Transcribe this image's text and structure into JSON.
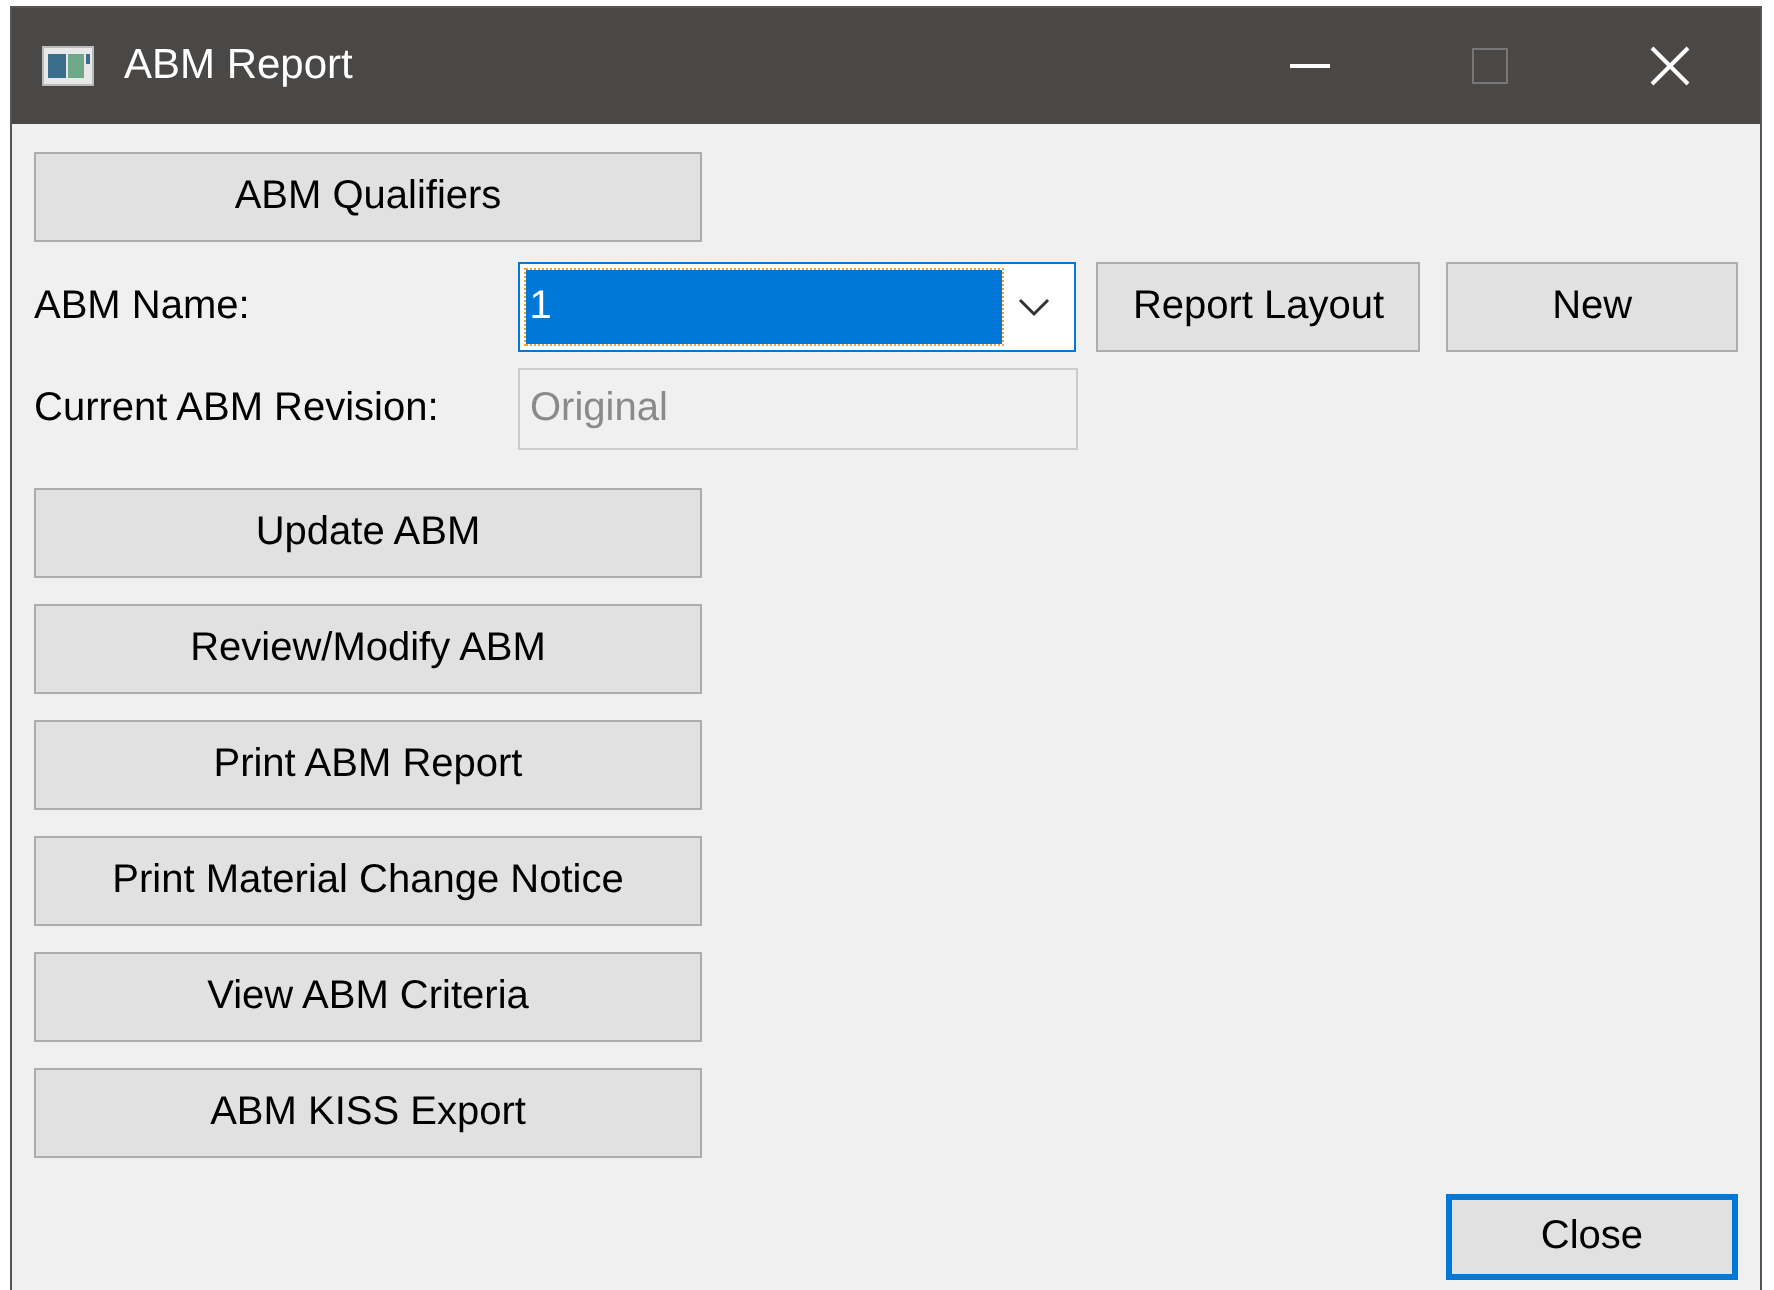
{
  "window": {
    "title": "ABM Report"
  },
  "qualifiers_button": "ABM Qualifiers",
  "abm_name": {
    "label": "ABM Name:",
    "value": "1",
    "focused": true
  },
  "report_layout_button": "Report Layout",
  "new_button": "New",
  "revision": {
    "label": "Current ABM Revision:",
    "value": "Original",
    "disabled": true
  },
  "actions": [
    "Update ABM",
    "Review/Modify ABM",
    "Print ABM Report",
    "Print Material Change Notice",
    "View ABM Criteria",
    "ABM KISS Export"
  ],
  "close_button": {
    "label": "Close",
    "focused": true
  }
}
